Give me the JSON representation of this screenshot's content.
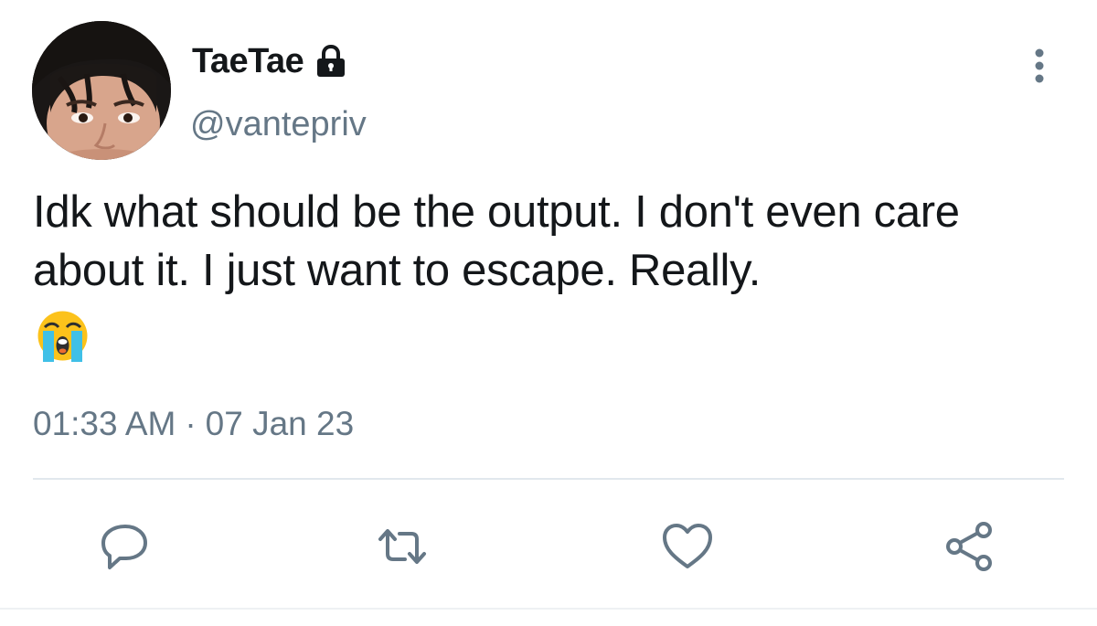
{
  "tweet": {
    "display_name": "TaeTae",
    "handle": "@vantepriv",
    "text": "Idk what should be the output. I don't even care about it. I just want to escape. Really.",
    "emoji": "loudly-crying-face",
    "time": "01:33 AM",
    "separator": "·",
    "date": "07 Jan 23"
  },
  "icons": {
    "lock": "lock-icon",
    "more": "more-vertical-icon",
    "reply": "reply-icon",
    "retweet": "retweet-icon",
    "like": "heart-icon",
    "share": "share-icon"
  },
  "colors": {
    "text": "#14171a",
    "secondary": "#657786",
    "divider": "#e1e8ed"
  }
}
